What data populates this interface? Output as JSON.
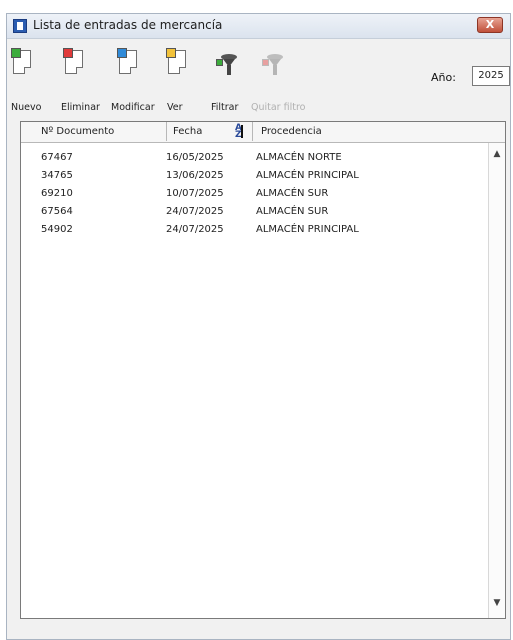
{
  "window": {
    "title": "Lista de entradas de mercancía"
  },
  "toolbar": {
    "buttons": [
      {
        "label": "Nuevo",
        "color": "#3cac3c"
      },
      {
        "label": "Eliminar",
        "color": "#e03a3a"
      },
      {
        "label": "Modificar",
        "color": "#2f8ad8"
      },
      {
        "label": "Ver",
        "color": "#f2c23a"
      },
      {
        "label": "Filtrar",
        "color": "#3cac3c"
      },
      {
        "label": "Quitar filtro",
        "color": "#e06a6a"
      }
    ],
    "year_label": "Año:",
    "year_value": "2025"
  },
  "table": {
    "columns": [
      "Nº Documento",
      "Fecha",
      "Procedencia"
    ],
    "sort_icon": "sort-az-icon",
    "rows": [
      {
        "doc": "67467",
        "fecha": "16/05/2025",
        "procedencia": "ALMACÉN NORTE"
      },
      {
        "doc": "34765",
        "fecha": "13/06/2025",
        "procedencia": "ALMACÉN PRINCIPAL"
      },
      {
        "doc": "69210",
        "fecha": "10/07/2025",
        "procedencia": "ALMACÉN SUR"
      },
      {
        "doc": "67564",
        "fecha": "24/07/2025",
        "procedencia": "ALMACÉN SUR"
      },
      {
        "doc": "54902",
        "fecha": "24/07/2025",
        "procedencia": "ALMACÉN PRINCIPAL"
      }
    ]
  },
  "close_glyph": "X"
}
